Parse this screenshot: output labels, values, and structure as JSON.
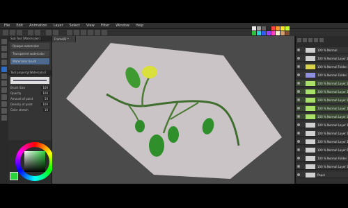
{
  "menu": [
    "File",
    "Edit",
    "Animation",
    "Layer",
    "Select",
    "View",
    "Filter",
    "Window",
    "Help"
  ],
  "document_tab": "Frame02 *",
  "subtool": {
    "header": "Sub Tool [Watercolor]",
    "items": [
      "Opaque watercolor",
      "Transparent watercolor",
      "Watercolor brush"
    ],
    "active_index": 2
  },
  "tool_property": {
    "header": "Tool property[Watercolor]",
    "brush_size_label": "Brush Size",
    "brush_size_value": "100",
    "opacity_label": "Opacity",
    "opacity_value": "100",
    "amount_label": "Amount of paint",
    "amount_value": "50",
    "density_label": "Density of paint",
    "density_value": "100",
    "stretch_label": "Color stretch",
    "stretch_value": "10"
  },
  "layers": [
    {
      "name": "100 % Normal",
      "color": "#cfcfcf",
      "highlight": false
    },
    {
      "name": "100 % Normal Layer 2",
      "color": "#cfcfcf",
      "highlight": false
    },
    {
      "name": "100 % Normal Folder 2",
      "color": "#d8d24a",
      "highlight": false
    },
    {
      "name": "100 % Normal Folder 1",
      "color": "#8f8fe0",
      "highlight": false
    },
    {
      "name": "100 % Normal Layer 17",
      "color": "#a9e06a",
      "highlight": true
    },
    {
      "name": "100 % Normal Layer 16",
      "color": "#a9e06a",
      "highlight": true
    },
    {
      "name": "100 % Normal Layer 15",
      "color": "#a9e06a",
      "highlight": true
    },
    {
      "name": "100 % Normal Layer 14",
      "color": "#a9e06a",
      "highlight": true
    },
    {
      "name": "100 % Normal Layer 13",
      "color": "#a9e06a",
      "highlight": true
    },
    {
      "name": "100 % Normal Layer 12",
      "color": "#cfcfcf",
      "highlight": false
    },
    {
      "name": "100 % Normal Layer 11",
      "color": "#cfcfcf",
      "highlight": false
    },
    {
      "name": "100 % Normal Layer 10",
      "color": "#cfcfcf",
      "highlight": false
    },
    {
      "name": "100 % Normal Layer 9",
      "color": "#cfcfcf",
      "highlight": false
    },
    {
      "name": "100 % Normal Folder 3",
      "color": "#cfcfcf",
      "highlight": false
    },
    {
      "name": "100 % Normal Layer 1",
      "color": "#cfcfcf",
      "highlight": false
    },
    {
      "name": "Paper",
      "color": "#cfcfcf",
      "highlight": false
    }
  ],
  "colors": {
    "accent": "#2e6bc5",
    "main_color": "#2bd33b",
    "paper": "#cbc4c6"
  }
}
